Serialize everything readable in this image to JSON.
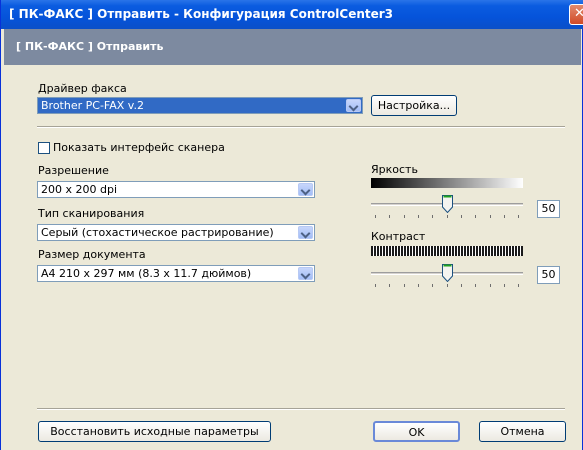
{
  "window": {
    "title": "[ ПК-ФАКС ]   Отправить - Конфигурация ControlCenter3",
    "close_glyph": "✕",
    "header": "[ ПК-ФАКС ]   Отправить"
  },
  "fax_driver": {
    "label": "Драйвер факса",
    "value": "Brother PC-FAX v.2",
    "setup_button": "Настройка..."
  },
  "show_scanner_ui": {
    "label": "Показать интерфейс сканера",
    "checked": false
  },
  "resolution": {
    "label": "Разрешение",
    "value": "200 x 200 dpi"
  },
  "scan_type": {
    "label": "Тип сканирования",
    "value": "Серый (стохастическое растрирование)"
  },
  "document_size": {
    "label": "Размер документа",
    "value": "A4 210 x 297 мм (8.3 x 11.7 дюймов)"
  },
  "brightness": {
    "label": "Яркость",
    "value": "50"
  },
  "contrast": {
    "label": "Контраст",
    "value": "50"
  },
  "buttons": {
    "restore_defaults": "Восстановить исходные параметры",
    "ok": "OK",
    "cancel": "Отмена"
  },
  "colors": {
    "title_bar": "#0553da",
    "header_strip": "#7d8aa0",
    "dialog_bg": "#ece9d8",
    "selection": "#316ac5"
  }
}
